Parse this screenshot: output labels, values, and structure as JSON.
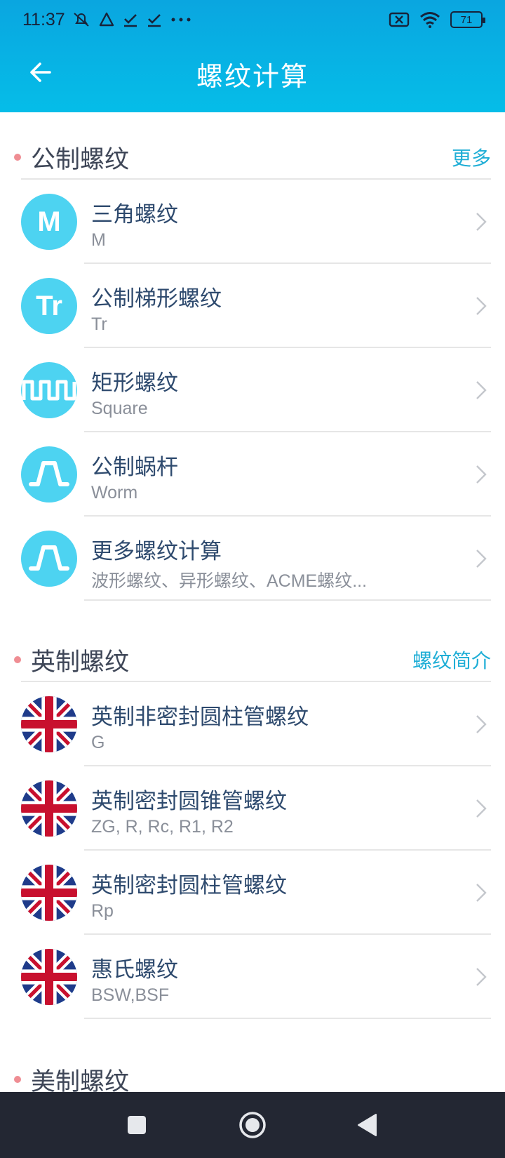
{
  "status": {
    "time": "11:37",
    "battery": "71"
  },
  "toolbar": {
    "title": "螺纹计算"
  },
  "colors": {
    "accent": "#05bde8",
    "link": "#1faed6",
    "dot": "#ef8d93",
    "icon_bg": "#4dd3f1"
  },
  "sections": [
    {
      "title": "公制螺纹",
      "link": "更多",
      "items": [
        {
          "icon": "M",
          "title": "三角螺纹",
          "sub": "M"
        },
        {
          "icon": "Tr",
          "title": "公制梯形螺纹",
          "sub": "Tr"
        },
        {
          "icon": "square-wave-icon",
          "title": "矩形螺纹",
          "sub": "Square"
        },
        {
          "icon": "trapezoid-wave-icon",
          "title": "公制蜗杆",
          "sub": "Worm"
        },
        {
          "icon": "trapezoid-wave-icon",
          "title": "更多螺纹计算",
          "sub": "波形螺纹、异形螺纹、ACME螺纹..."
        }
      ]
    },
    {
      "title": "英制螺纹",
      "link": "螺纹简介",
      "items": [
        {
          "icon": "uk-flag-icon",
          "title": "英制非密封圆柱管螺纹",
          "sub": "G"
        },
        {
          "icon": "uk-flag-icon",
          "title": "英制密封圆锥管螺纹",
          "sub": "ZG, R, Rc, R1, R2"
        },
        {
          "icon": "uk-flag-icon",
          "title": "英制密封圆柱管螺纹",
          "sub": "Rp"
        },
        {
          "icon": "uk-flag-icon",
          "title": "惠氏螺纹",
          "sub": "BSW,BSF"
        }
      ]
    },
    {
      "title": "美制螺纹"
    }
  ]
}
